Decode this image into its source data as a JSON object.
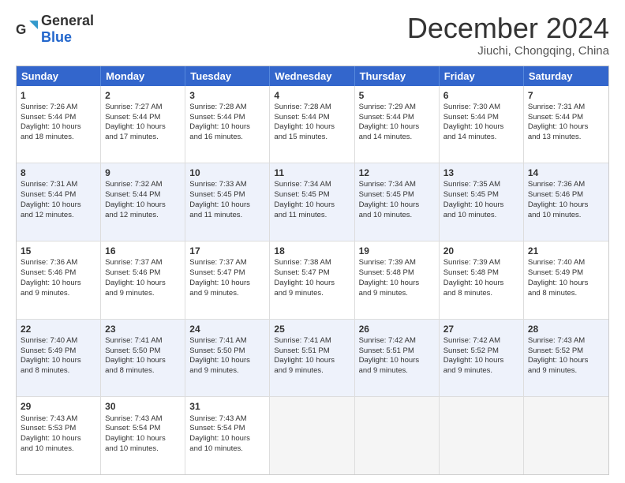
{
  "logo": {
    "general": "General",
    "blue": "Blue"
  },
  "title": "December 2024",
  "location": "Jiuchi, Chongqing, China",
  "calendar": {
    "headers": [
      "Sunday",
      "Monday",
      "Tuesday",
      "Wednesday",
      "Thursday",
      "Friday",
      "Saturday"
    ],
    "rows": [
      [
        {
          "day": "1",
          "lines": [
            "Sunrise: 7:26 AM",
            "Sunset: 5:44 PM",
            "Daylight: 10 hours",
            "and 18 minutes."
          ]
        },
        {
          "day": "2",
          "lines": [
            "Sunrise: 7:27 AM",
            "Sunset: 5:44 PM",
            "Daylight: 10 hours",
            "and 17 minutes."
          ]
        },
        {
          "day": "3",
          "lines": [
            "Sunrise: 7:28 AM",
            "Sunset: 5:44 PM",
            "Daylight: 10 hours",
            "and 16 minutes."
          ]
        },
        {
          "day": "4",
          "lines": [
            "Sunrise: 7:28 AM",
            "Sunset: 5:44 PM",
            "Daylight: 10 hours",
            "and 15 minutes."
          ]
        },
        {
          "day": "5",
          "lines": [
            "Sunrise: 7:29 AM",
            "Sunset: 5:44 PM",
            "Daylight: 10 hours",
            "and 14 minutes."
          ]
        },
        {
          "day": "6",
          "lines": [
            "Sunrise: 7:30 AM",
            "Sunset: 5:44 PM",
            "Daylight: 10 hours",
            "and 14 minutes."
          ]
        },
        {
          "day": "7",
          "lines": [
            "Sunrise: 7:31 AM",
            "Sunset: 5:44 PM",
            "Daylight: 10 hours",
            "and 13 minutes."
          ]
        }
      ],
      [
        {
          "day": "8",
          "lines": [
            "Sunrise: 7:31 AM",
            "Sunset: 5:44 PM",
            "Daylight: 10 hours",
            "and 12 minutes."
          ]
        },
        {
          "day": "9",
          "lines": [
            "Sunrise: 7:32 AM",
            "Sunset: 5:44 PM",
            "Daylight: 10 hours",
            "and 12 minutes."
          ]
        },
        {
          "day": "10",
          "lines": [
            "Sunrise: 7:33 AM",
            "Sunset: 5:45 PM",
            "Daylight: 10 hours",
            "and 11 minutes."
          ]
        },
        {
          "day": "11",
          "lines": [
            "Sunrise: 7:34 AM",
            "Sunset: 5:45 PM",
            "Daylight: 10 hours",
            "and 11 minutes."
          ]
        },
        {
          "day": "12",
          "lines": [
            "Sunrise: 7:34 AM",
            "Sunset: 5:45 PM",
            "Daylight: 10 hours",
            "and 10 minutes."
          ]
        },
        {
          "day": "13",
          "lines": [
            "Sunrise: 7:35 AM",
            "Sunset: 5:45 PM",
            "Daylight: 10 hours",
            "and 10 minutes."
          ]
        },
        {
          "day": "14",
          "lines": [
            "Sunrise: 7:36 AM",
            "Sunset: 5:46 PM",
            "Daylight: 10 hours",
            "and 10 minutes."
          ]
        }
      ],
      [
        {
          "day": "15",
          "lines": [
            "Sunrise: 7:36 AM",
            "Sunset: 5:46 PM",
            "Daylight: 10 hours",
            "and 9 minutes."
          ]
        },
        {
          "day": "16",
          "lines": [
            "Sunrise: 7:37 AM",
            "Sunset: 5:46 PM",
            "Daylight: 10 hours",
            "and 9 minutes."
          ]
        },
        {
          "day": "17",
          "lines": [
            "Sunrise: 7:37 AM",
            "Sunset: 5:47 PM",
            "Daylight: 10 hours",
            "and 9 minutes."
          ]
        },
        {
          "day": "18",
          "lines": [
            "Sunrise: 7:38 AM",
            "Sunset: 5:47 PM",
            "Daylight: 10 hours",
            "and 9 minutes."
          ]
        },
        {
          "day": "19",
          "lines": [
            "Sunrise: 7:39 AM",
            "Sunset: 5:48 PM",
            "Daylight: 10 hours",
            "and 9 minutes."
          ]
        },
        {
          "day": "20",
          "lines": [
            "Sunrise: 7:39 AM",
            "Sunset: 5:48 PM",
            "Daylight: 10 hours",
            "and 8 minutes."
          ]
        },
        {
          "day": "21",
          "lines": [
            "Sunrise: 7:40 AM",
            "Sunset: 5:49 PM",
            "Daylight: 10 hours",
            "and 8 minutes."
          ]
        }
      ],
      [
        {
          "day": "22",
          "lines": [
            "Sunrise: 7:40 AM",
            "Sunset: 5:49 PM",
            "Daylight: 10 hours",
            "and 8 minutes."
          ]
        },
        {
          "day": "23",
          "lines": [
            "Sunrise: 7:41 AM",
            "Sunset: 5:50 PM",
            "Daylight: 10 hours",
            "and 8 minutes."
          ]
        },
        {
          "day": "24",
          "lines": [
            "Sunrise: 7:41 AM",
            "Sunset: 5:50 PM",
            "Daylight: 10 hours",
            "and 9 minutes."
          ]
        },
        {
          "day": "25",
          "lines": [
            "Sunrise: 7:41 AM",
            "Sunset: 5:51 PM",
            "Daylight: 10 hours",
            "and 9 minutes."
          ]
        },
        {
          "day": "26",
          "lines": [
            "Sunrise: 7:42 AM",
            "Sunset: 5:51 PM",
            "Daylight: 10 hours",
            "and 9 minutes."
          ]
        },
        {
          "day": "27",
          "lines": [
            "Sunrise: 7:42 AM",
            "Sunset: 5:52 PM",
            "Daylight: 10 hours",
            "and 9 minutes."
          ]
        },
        {
          "day": "28",
          "lines": [
            "Sunrise: 7:43 AM",
            "Sunset: 5:52 PM",
            "Daylight: 10 hours",
            "and 9 minutes."
          ]
        }
      ],
      [
        {
          "day": "29",
          "lines": [
            "Sunrise: 7:43 AM",
            "Sunset: 5:53 PM",
            "Daylight: 10 hours",
            "and 10 minutes."
          ]
        },
        {
          "day": "30",
          "lines": [
            "Sunrise: 7:43 AM",
            "Sunset: 5:54 PM",
            "Daylight: 10 hours",
            "and 10 minutes."
          ]
        },
        {
          "day": "31",
          "lines": [
            "Sunrise: 7:43 AM",
            "Sunset: 5:54 PM",
            "Daylight: 10 hours",
            "and 10 minutes."
          ]
        },
        {
          "day": "",
          "lines": []
        },
        {
          "day": "",
          "lines": []
        },
        {
          "day": "",
          "lines": []
        },
        {
          "day": "",
          "lines": []
        }
      ]
    ]
  }
}
